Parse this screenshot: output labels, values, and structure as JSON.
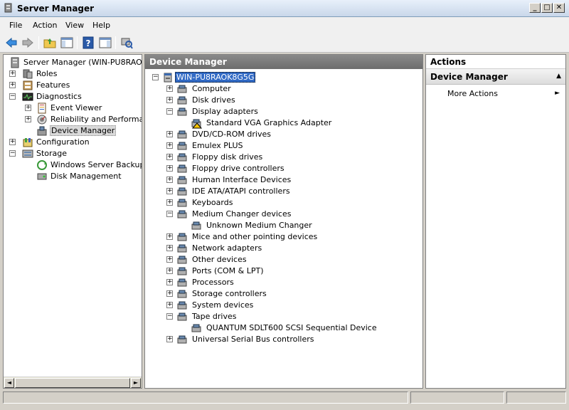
{
  "window": {
    "title": "Server Manager",
    "buttons": {
      "minimize": "_",
      "maximize": "□",
      "close": "✕"
    }
  },
  "menu": {
    "items": [
      {
        "label": "File"
      },
      {
        "label": "Action"
      },
      {
        "label": "View"
      },
      {
        "label": "Help"
      }
    ]
  },
  "toolbar": {
    "icons": [
      "back-arrow-icon",
      "forward-arrow-icon",
      "up-folder-icon",
      "show-hide-tree-icon",
      "help-icon",
      "show-hide-action-icon",
      "scan-hardware-icon"
    ]
  },
  "left_tree": {
    "items": [
      {
        "label": "Server Manager (WIN-PU8RAOK8G",
        "icon": "server-icon"
      },
      {
        "label": "Roles",
        "icon": "roles-icon",
        "expander": "+"
      },
      {
        "label": "Features",
        "icon": "features-icon",
        "expander": "+"
      },
      {
        "label": "Diagnostics",
        "icon": "diagnostics-icon",
        "expander": "−"
      },
      {
        "label": "Event Viewer",
        "icon": "event-viewer-icon",
        "expander": "+"
      },
      {
        "label": "Reliability and Performance",
        "icon": "reliability-icon",
        "expander": "+"
      },
      {
        "label": "Device Manager",
        "icon": "device-manager-icon",
        "selected": true
      },
      {
        "label": "Configuration",
        "icon": "configuration-icon",
        "expander": "+"
      },
      {
        "label": "Storage",
        "icon": "storage-icon",
        "expander": "−"
      },
      {
        "label": "Windows Server Backup",
        "icon": "backup-icon"
      },
      {
        "label": "Disk Management",
        "icon": "disk-management-icon"
      }
    ],
    "scroll_left": "◄",
    "scroll_right": "►"
  },
  "device_manager": {
    "header": "Device Manager",
    "root": "WIN-PU8RAOK8G5G",
    "nodes": [
      {
        "label": "Computer",
        "expander": "+"
      },
      {
        "label": "Disk drives",
        "expander": "+"
      },
      {
        "label": "Display adapters",
        "expander": "−"
      },
      {
        "label": "Standard VGA Graphics Adapter",
        "child": true,
        "warning": true
      },
      {
        "label": "DVD/CD-ROM drives",
        "expander": "+"
      },
      {
        "label": "Emulex PLUS",
        "expander": "+"
      },
      {
        "label": "Floppy disk drives",
        "expander": "+"
      },
      {
        "label": "Floppy drive controllers",
        "expander": "+"
      },
      {
        "label": "Human Interface Devices",
        "expander": "+"
      },
      {
        "label": "IDE ATA/ATAPI controllers",
        "expander": "+"
      },
      {
        "label": "Keyboards",
        "expander": "+"
      },
      {
        "label": "Medium Changer devices",
        "expander": "−"
      },
      {
        "label": "Unknown Medium Changer",
        "child": true
      },
      {
        "label": "Mice and other pointing devices",
        "expander": "+"
      },
      {
        "label": "Network adapters",
        "expander": "+"
      },
      {
        "label": "Other devices",
        "expander": "+"
      },
      {
        "label": "Ports (COM & LPT)",
        "expander": "+"
      },
      {
        "label": "Processors",
        "expander": "+"
      },
      {
        "label": "Storage controllers",
        "expander": "+"
      },
      {
        "label": "System devices",
        "expander": "+"
      },
      {
        "label": "Tape drives",
        "expander": "−"
      },
      {
        "label": "QUANTUM SDLT600 SCSI Sequential Device",
        "child": true
      },
      {
        "label": "Universal Serial Bus controllers",
        "expander": "+"
      }
    ]
  },
  "actions": {
    "header": "Actions",
    "section": "Device Manager",
    "collapse_glyph": "▲",
    "more_actions": "More Actions",
    "more_glyph": "►"
  },
  "colors": {
    "accent": "#316ac5",
    "pane_header": "#6d6d6d",
    "warning": "#f5c400"
  }
}
